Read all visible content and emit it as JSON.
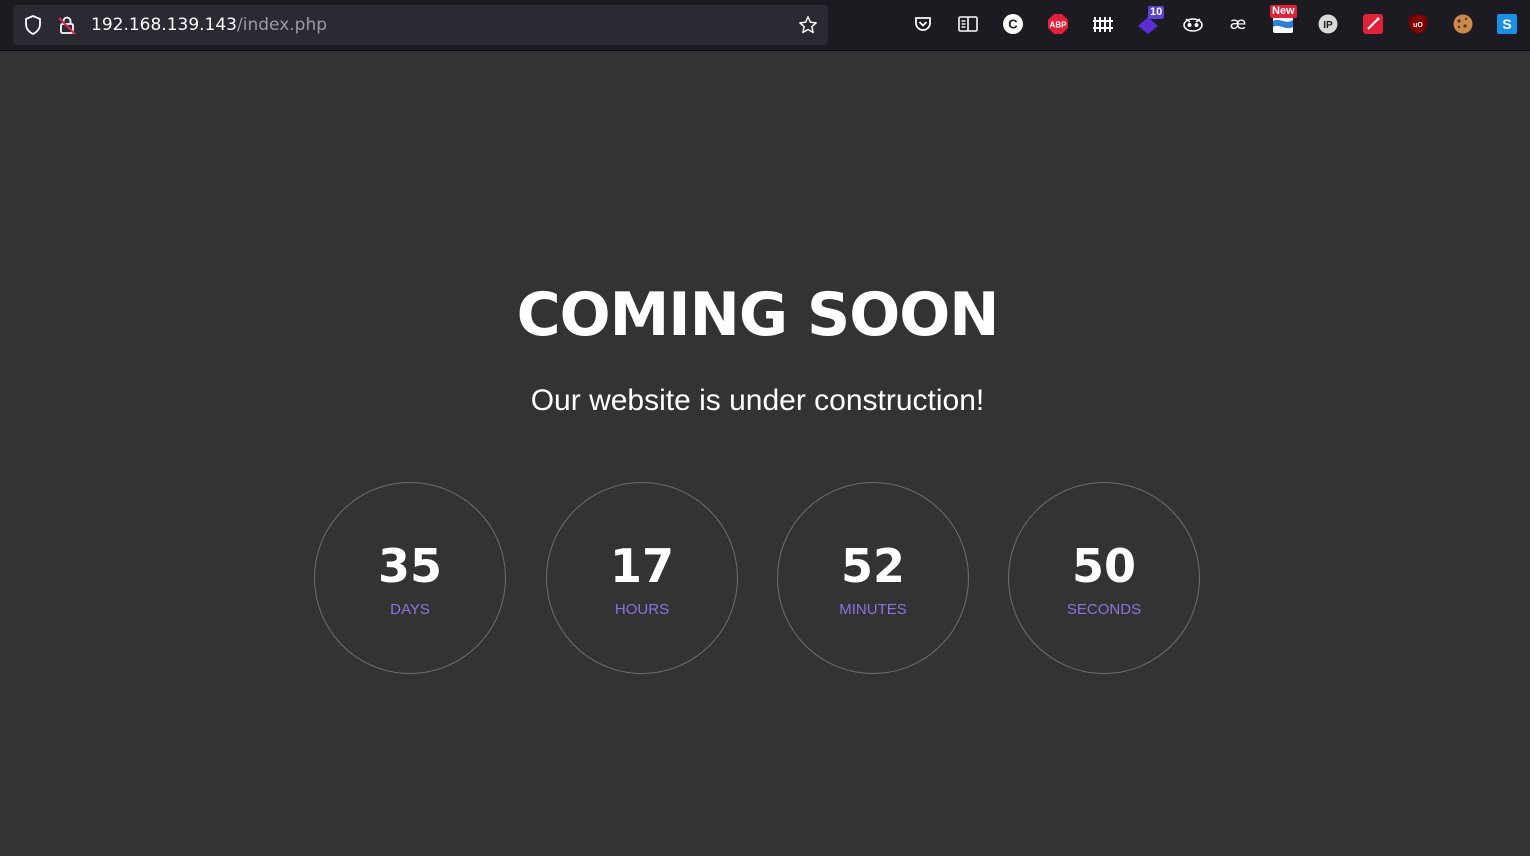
{
  "browser": {
    "url_host": "192.168.139.143",
    "url_path": "/index.php",
    "extensions": [
      {
        "name": "pocket-icon"
      },
      {
        "name": "reader-view-icon"
      },
      {
        "name": "c-extension-icon",
        "label": "C"
      },
      {
        "name": "adblock-plus-icon",
        "label": "ABP"
      },
      {
        "name": "fence-extension-icon"
      },
      {
        "name": "purple-extension-icon",
        "badge": "10"
      },
      {
        "name": "tampermonkey-icon"
      },
      {
        "name": "ae-extension-icon",
        "label": "æ"
      },
      {
        "name": "s-flag-extension-icon",
        "badge": "New"
      },
      {
        "name": "ip-extension-icon",
        "label": "IP"
      },
      {
        "name": "magic-wand-extension-icon"
      },
      {
        "name": "ublock-origin-icon",
        "label": "uO"
      },
      {
        "name": "cookie-extension-icon"
      },
      {
        "name": "s-extension-icon",
        "label": "S"
      }
    ]
  },
  "page": {
    "title": "COMING SOON",
    "subtitle": "Our website is under construction!",
    "countdown": [
      {
        "value": "35",
        "label": "DAYS"
      },
      {
        "value": "17",
        "label": "HOURS"
      },
      {
        "value": "52",
        "label": "MINUTES"
      },
      {
        "value": "50",
        "label": "SECONDS"
      }
    ]
  },
  "colors": {
    "background": "#333333",
    "accent": "#8b74e0",
    "ring": "#6e6e6e"
  }
}
